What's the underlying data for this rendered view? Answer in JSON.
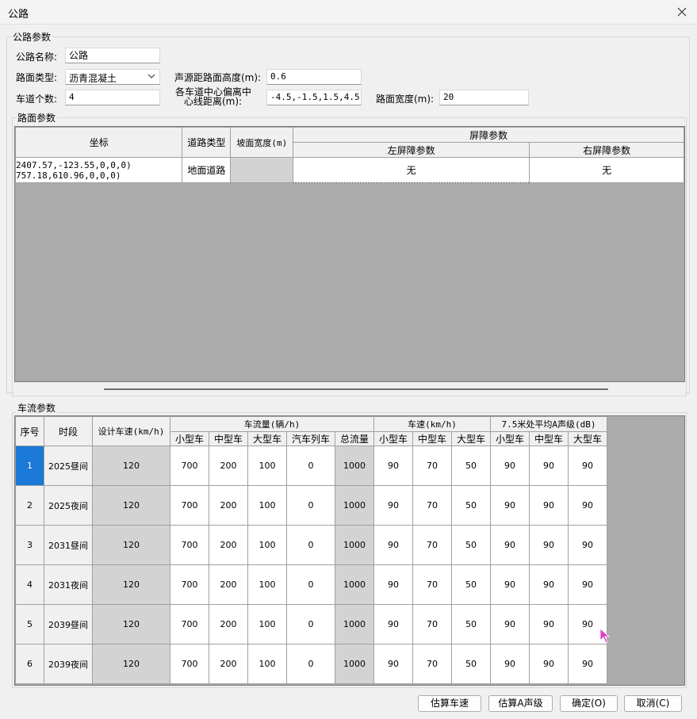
{
  "window": {
    "title": "公路"
  },
  "road_params": {
    "group_title": "公路参数",
    "name_label": "公路名称:",
    "name_value": "公路",
    "surface_label": "路面类型:",
    "surface_value": "沥青混凝土",
    "lanes_label": "车道个数:",
    "lanes_value": "4",
    "source_height_label": "声源距路面高度(m):",
    "source_height_value": "0.6",
    "lane_offset_label_1": "各车道中心偏离中",
    "lane_offset_label_2": "心线距离(m):",
    "lane_offset_value": "-4.5,-1.5,1.5,4.5",
    "road_width_label": "路面宽度(m):",
    "road_width_value": "20"
  },
  "surface_params": {
    "group_title": "路面参数",
    "headers": {
      "coords": "坐标",
      "road_type": "道路类型",
      "slope_width": "坡面宽度(m)",
      "barrier": "屏障参数",
      "left_barrier": "左屏障参数",
      "right_barrier": "右屏障参数"
    },
    "row": {
      "coord_line1": "2407.57,-123.55,0,0,0)",
      "coord_line2": "757.18,610.96,0,0,0)",
      "road_type": "地面道路",
      "slope_width": "",
      "left_barrier": "无",
      "right_barrier": "无"
    }
  },
  "traffic_params": {
    "group_title": "车流参数",
    "headers": {
      "index": "序号",
      "period": "时段",
      "design_speed": "设计车速(km/h)",
      "flow": "车流量(辆/h)",
      "speed": "车速(km/h)",
      "noise": "7.5米处平均A声级(dB)",
      "small": "小型车",
      "medium": "中型车",
      "large": "大型车",
      "train": "汽车列车",
      "total": "总流量"
    },
    "rows": [
      {
        "index": "1",
        "period": "2025昼间",
        "design_speed": "120",
        "flow_small": "700",
        "flow_medium": "200",
        "flow_large": "100",
        "flow_train": "0",
        "flow_total": "1000",
        "speed_small": "90",
        "speed_medium": "70",
        "speed_large": "50",
        "noise_small": "90",
        "noise_medium": "90",
        "noise_large": "90"
      },
      {
        "index": "2",
        "period": "2025夜间",
        "design_speed": "120",
        "flow_small": "700",
        "flow_medium": "200",
        "flow_large": "100",
        "flow_train": "0",
        "flow_total": "1000",
        "speed_small": "90",
        "speed_medium": "70",
        "speed_large": "50",
        "noise_small": "90",
        "noise_medium": "90",
        "noise_large": "90"
      },
      {
        "index": "3",
        "period": "2031昼间",
        "design_speed": "120",
        "flow_small": "700",
        "flow_medium": "200",
        "flow_large": "100",
        "flow_train": "0",
        "flow_total": "1000",
        "speed_small": "90",
        "speed_medium": "70",
        "speed_large": "50",
        "noise_small": "90",
        "noise_medium": "90",
        "noise_large": "90"
      },
      {
        "index": "4",
        "period": "2031夜间",
        "design_speed": "120",
        "flow_small": "700",
        "flow_medium": "200",
        "flow_large": "100",
        "flow_train": "0",
        "flow_total": "1000",
        "speed_small": "90",
        "speed_medium": "70",
        "speed_large": "50",
        "noise_small": "90",
        "noise_medium": "90",
        "noise_large": "90"
      },
      {
        "index": "5",
        "period": "2039昼间",
        "design_speed": "120",
        "flow_small": "700",
        "flow_medium": "200",
        "flow_large": "100",
        "flow_train": "0",
        "flow_total": "1000",
        "speed_small": "90",
        "speed_medium": "70",
        "speed_large": "50",
        "noise_small": "90",
        "noise_medium": "90",
        "noise_large": "90"
      },
      {
        "index": "6",
        "period": "2039夜间",
        "design_speed": "120",
        "flow_small": "700",
        "flow_medium": "200",
        "flow_large": "100",
        "flow_train": "0",
        "flow_total": "1000",
        "speed_small": "90",
        "speed_medium": "70",
        "speed_large": "50",
        "noise_small": "90",
        "noise_medium": "90",
        "noise_large": "90"
      }
    ]
  },
  "buttons": {
    "estimate_speed": "估算车速",
    "estimate_noise": "估算A声级",
    "ok": "确定(O)",
    "cancel": "取消(C)"
  },
  "colors": {
    "selection": "#1a78d6",
    "grid_bg": "#ababab",
    "readonly_cell": "#d3d3d3"
  }
}
